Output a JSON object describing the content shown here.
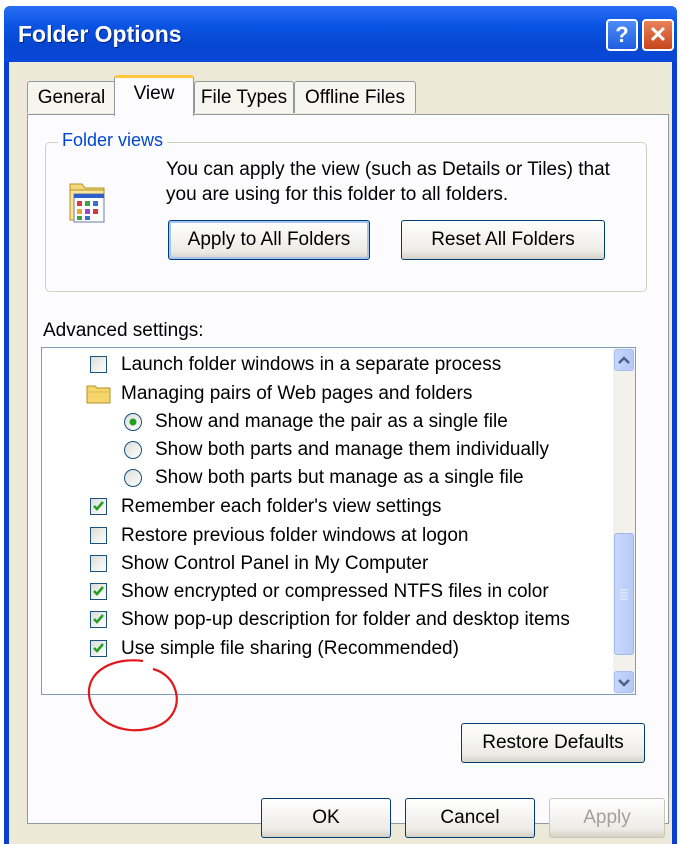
{
  "window": {
    "title": "Folder Options",
    "help_glyph": "?",
    "close_glyph": "✕"
  },
  "tabs": [
    {
      "label": "General"
    },
    {
      "label": "View",
      "active": true
    },
    {
      "label": "File Types"
    },
    {
      "label": "Offline Files"
    }
  ],
  "folder_views": {
    "title": "Folder views",
    "description": "You can apply the view (such as Details or Tiles) that you are using for this folder to all folders.",
    "apply_label": "Apply to All Folders",
    "reset_label": "Reset All Folders"
  },
  "advanced": {
    "label": "Advanced settings:",
    "items": [
      {
        "type": "checkbox",
        "checked": false,
        "label": "Launch folder windows in a separate process"
      },
      {
        "type": "folder",
        "label": "Managing pairs of Web pages and folders"
      },
      {
        "type": "radio",
        "checked": true,
        "label": "Show and manage the pair as a single file"
      },
      {
        "type": "radio",
        "checked": false,
        "label": "Show both parts and manage them individually"
      },
      {
        "type": "radio",
        "checked": false,
        "label": "Show both parts but manage as a single file"
      },
      {
        "type": "checkbox",
        "checked": true,
        "label": "Remember each folder's view settings"
      },
      {
        "type": "checkbox",
        "checked": false,
        "label": "Restore previous folder windows at logon"
      },
      {
        "type": "checkbox",
        "checked": false,
        "label": "Show Control Panel in My Computer"
      },
      {
        "type": "checkbox",
        "checked": true,
        "label": "Show encrypted or compressed NTFS files in color"
      },
      {
        "type": "checkbox",
        "checked": true,
        "label": "Show pop-up description for folder and desktop items"
      },
      {
        "type": "checkbox",
        "checked": true,
        "label": "Use simple file sharing (Recommended)"
      }
    ]
  },
  "restore_defaults_label": "Restore Defaults",
  "footer": {
    "ok_label": "OK",
    "cancel_label": "Cancel",
    "apply_label": "Apply"
  },
  "colors": {
    "titlebar": "#0a54e3",
    "dialog_bg": "#ece9d8",
    "annotation": "#e0181c",
    "check": "#21a121"
  }
}
